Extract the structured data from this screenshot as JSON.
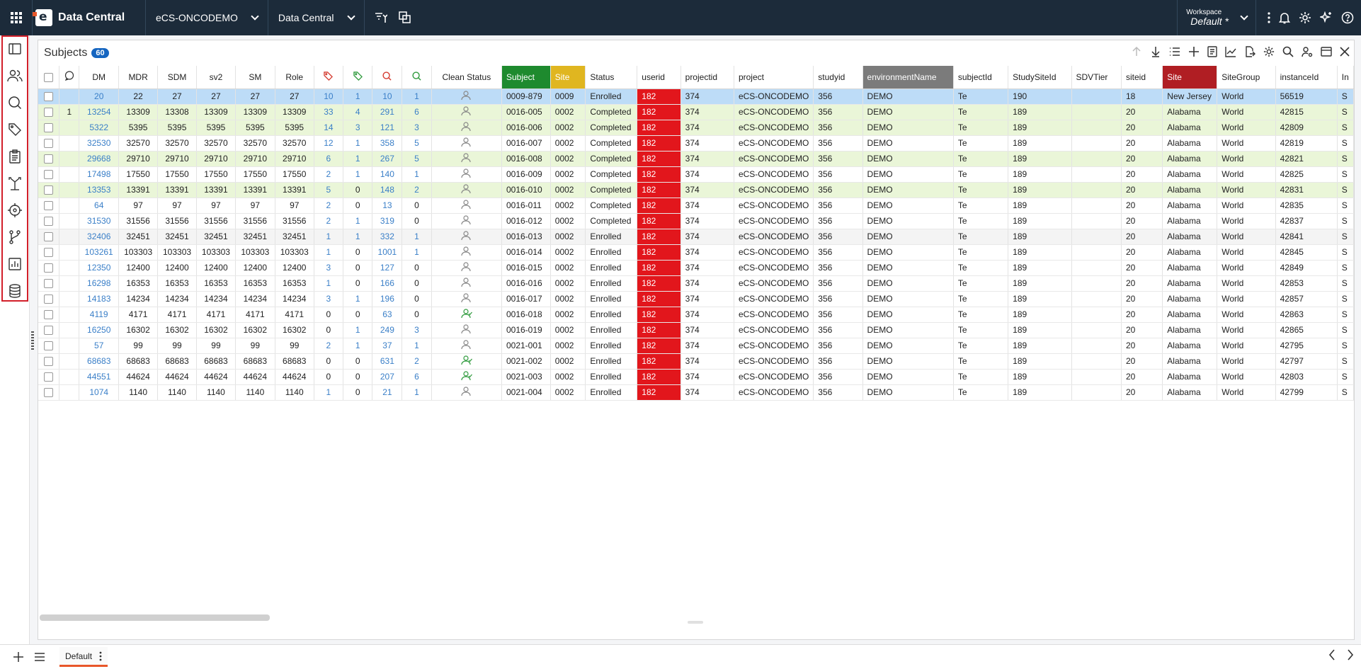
{
  "header": {
    "app_title": "Data Central",
    "study_selector": "eCS-ONCODEMO",
    "module_selector": "Data Central",
    "workspace_label": "Workspace",
    "workspace_value": "Default",
    "workspace_marker": "*"
  },
  "rail": {
    "items": [
      "panel-toggle-icon",
      "subjects-icon",
      "queries-icon",
      "tags-icon",
      "clipboard-icon",
      "branch-arrows-icon",
      "target-icon",
      "git-fork-icon",
      "bar-chart-icon",
      "database-icon"
    ]
  },
  "panel": {
    "title": "Subjects",
    "count": "60"
  },
  "table": {
    "headers": [
      "",
      "",
      "DM",
      "MDR",
      "SDM",
      "sv2",
      "SM",
      "Role",
      "",
      "",
      "",
      "",
      "Clean Status",
      "Subject",
      "Site",
      "Status",
      "userid",
      "projectid",
      "project",
      "studyid",
      "environmentName",
      "subjectId",
      "StudySiteId",
      "SDVTier",
      "siteid",
      "Site",
      "SiteGroup",
      "instanceId",
      "In"
    ],
    "rows": [
      {
        "c": "",
        "dm": "20",
        "mdr": "22",
        "sdm": "27",
        "sv2": "27",
        "sm": "27",
        "role": "27",
        "t1": "10",
        "t2": "1",
        "q1": "10",
        "q2": "1",
        "clean": "person",
        "subject": "0009-879",
        "site": "0009",
        "status": "Enrolled",
        "userid": "182",
        "projectid": "374",
        "project": "eCS-ONCODEMO",
        "studyid": "356",
        "env": "DEMO",
        "subjectId": "Te",
        "studySiteId": "190",
        "sdv": "",
        "siteid": "18",
        "site2": "New Jersey",
        "sitegroup": "World",
        "instance": "56519",
        "in": "S"
      },
      {
        "c": "1",
        "dm": "13254",
        "mdr": "13309",
        "sdm": "13308",
        "sv2": "13309",
        "sm": "13309",
        "role": "13309",
        "t1": "33",
        "t2": "4",
        "q1": "291",
        "q2": "6",
        "clean": "person",
        "subject": "0016-005",
        "site": "0002",
        "status": "Completed",
        "userid": "182",
        "projectid": "374",
        "project": "eCS-ONCODEMO",
        "studyid": "356",
        "env": "DEMO",
        "subjectId": "Te",
        "studySiteId": "189",
        "sdv": "",
        "siteid": "20",
        "site2": "Alabama",
        "sitegroup": "World",
        "instance": "42815",
        "in": "S"
      },
      {
        "c": "",
        "dm": "5322",
        "mdr": "5395",
        "sdm": "5395",
        "sv2": "5395",
        "sm": "5395",
        "role": "5395",
        "t1": "14",
        "t2": "3",
        "q1": "121",
        "q2": "3",
        "clean": "person",
        "subject": "0016-006",
        "site": "0002",
        "status": "Completed",
        "userid": "182",
        "projectid": "374",
        "project": "eCS-ONCODEMO",
        "studyid": "356",
        "env": "DEMO",
        "subjectId": "Te",
        "studySiteId": "189",
        "sdv": "",
        "siteid": "20",
        "site2": "Alabama",
        "sitegroup": "World",
        "instance": "42809",
        "in": "S"
      },
      {
        "c": "",
        "dm": "32530",
        "mdr": "32570",
        "sdm": "32570",
        "sv2": "32570",
        "sm": "32570",
        "role": "32570",
        "t1": "12",
        "t2": "1",
        "q1": "358",
        "q2": "5",
        "clean": "person",
        "subject": "0016-007",
        "site": "0002",
        "status": "Completed",
        "userid": "182",
        "projectid": "374",
        "project": "eCS-ONCODEMO",
        "studyid": "356",
        "env": "DEMO",
        "subjectId": "Te",
        "studySiteId": "189",
        "sdv": "",
        "siteid": "20",
        "site2": "Alabama",
        "sitegroup": "World",
        "instance": "42819",
        "in": "S"
      },
      {
        "c": "",
        "dm": "29668",
        "mdr": "29710",
        "sdm": "29710",
        "sv2": "29710",
        "sm": "29710",
        "role": "29710",
        "t1": "6",
        "t2": "1",
        "q1": "267",
        "q2": "5",
        "clean": "person",
        "subject": "0016-008",
        "site": "0002",
        "status": "Completed",
        "userid": "182",
        "projectid": "374",
        "project": "eCS-ONCODEMO",
        "studyid": "356",
        "env": "DEMO",
        "subjectId": "Te",
        "studySiteId": "189",
        "sdv": "",
        "siteid": "20",
        "site2": "Alabama",
        "sitegroup": "World",
        "instance": "42821",
        "in": "S"
      },
      {
        "c": "",
        "dm": "17498",
        "mdr": "17550",
        "sdm": "17550",
        "sv2": "17550",
        "sm": "17550",
        "role": "17550",
        "t1": "2",
        "t2": "1",
        "q1": "140",
        "q2": "1",
        "clean": "person",
        "subject": "0016-009",
        "site": "0002",
        "status": "Completed",
        "userid": "182",
        "projectid": "374",
        "project": "eCS-ONCODEMO",
        "studyid": "356",
        "env": "DEMO",
        "subjectId": "Te",
        "studySiteId": "189",
        "sdv": "",
        "siteid": "20",
        "site2": "Alabama",
        "sitegroup": "World",
        "instance": "42825",
        "in": "S"
      },
      {
        "c": "",
        "dm": "13353",
        "mdr": "13391",
        "sdm": "13391",
        "sv2": "13391",
        "sm": "13391",
        "role": "13391",
        "t1": "5",
        "t2": "0",
        "q1": "148",
        "q2": "2",
        "clean": "person",
        "subject": "0016-010",
        "site": "0002",
        "status": "Completed",
        "userid": "182",
        "projectid": "374",
        "project": "eCS-ONCODEMO",
        "studyid": "356",
        "env": "DEMO",
        "subjectId": "Te",
        "studySiteId": "189",
        "sdv": "",
        "siteid": "20",
        "site2": "Alabama",
        "sitegroup": "World",
        "instance": "42831",
        "in": "S"
      },
      {
        "c": "",
        "dm": "64",
        "mdr": "97",
        "sdm": "97",
        "sv2": "97",
        "sm": "97",
        "role": "97",
        "t1": "2",
        "t2": "0",
        "q1": "13",
        "q2": "0",
        "clean": "person",
        "subject": "0016-011",
        "site": "0002",
        "status": "Completed",
        "userid": "182",
        "projectid": "374",
        "project": "eCS-ONCODEMO",
        "studyid": "356",
        "env": "DEMO",
        "subjectId": "Te",
        "studySiteId": "189",
        "sdv": "",
        "siteid": "20",
        "site2": "Alabama",
        "sitegroup": "World",
        "instance": "42835",
        "in": "S"
      },
      {
        "c": "",
        "dm": "31530",
        "mdr": "31556",
        "sdm": "31556",
        "sv2": "31556",
        "sm": "31556",
        "role": "31556",
        "t1": "2",
        "t2": "1",
        "q1": "319",
        "q2": "0",
        "clean": "person",
        "subject": "0016-012",
        "site": "0002",
        "status": "Completed",
        "userid": "182",
        "projectid": "374",
        "project": "eCS-ONCODEMO",
        "studyid": "356",
        "env": "DEMO",
        "subjectId": "Te",
        "studySiteId": "189",
        "sdv": "",
        "siteid": "20",
        "site2": "Alabama",
        "sitegroup": "World",
        "instance": "42837",
        "in": "S"
      },
      {
        "c": "",
        "dm": "32406",
        "mdr": "32451",
        "sdm": "32451",
        "sv2": "32451",
        "sm": "32451",
        "role": "32451",
        "t1": "1",
        "t2": "1",
        "q1": "332",
        "q2": "1",
        "clean": "person",
        "subject": "0016-013",
        "site": "0002",
        "status": "Enrolled",
        "userid": "182",
        "projectid": "374",
        "project": "eCS-ONCODEMO",
        "studyid": "356",
        "env": "DEMO",
        "subjectId": "Te",
        "studySiteId": "189",
        "sdv": "",
        "siteid": "20",
        "site2": "Alabama",
        "sitegroup": "World",
        "instance": "42841",
        "in": "S"
      },
      {
        "c": "",
        "dm": "103261",
        "mdr": "103303",
        "sdm": "103303",
        "sv2": "103303",
        "sm": "103303",
        "role": "103303",
        "t1": "1",
        "t2": "0",
        "q1": "1001",
        "q2": "1",
        "clean": "person",
        "subject": "0016-014",
        "site": "0002",
        "status": "Enrolled",
        "userid": "182",
        "projectid": "374",
        "project": "eCS-ONCODEMO",
        "studyid": "356",
        "env": "DEMO",
        "subjectId": "Te",
        "studySiteId": "189",
        "sdv": "",
        "siteid": "20",
        "site2": "Alabama",
        "sitegroup": "World",
        "instance": "42845",
        "in": "S"
      },
      {
        "c": "",
        "dm": "12350",
        "mdr": "12400",
        "sdm": "12400",
        "sv2": "12400",
        "sm": "12400",
        "role": "12400",
        "t1": "3",
        "t2": "0",
        "q1": "127",
        "q2": "0",
        "clean": "person",
        "subject": "0016-015",
        "site": "0002",
        "status": "Enrolled",
        "userid": "182",
        "projectid": "374",
        "project": "eCS-ONCODEMO",
        "studyid": "356",
        "env": "DEMO",
        "subjectId": "Te",
        "studySiteId": "189",
        "sdv": "",
        "siteid": "20",
        "site2": "Alabama",
        "sitegroup": "World",
        "instance": "42849",
        "in": "S"
      },
      {
        "c": "",
        "dm": "16298",
        "mdr": "16353",
        "sdm": "16353",
        "sv2": "16353",
        "sm": "16353",
        "role": "16353",
        "t1": "1",
        "t2": "0",
        "q1": "166",
        "q2": "0",
        "clean": "person",
        "subject": "0016-016",
        "site": "0002",
        "status": "Enrolled",
        "userid": "182",
        "projectid": "374",
        "project": "eCS-ONCODEMO",
        "studyid": "356",
        "env": "DEMO",
        "subjectId": "Te",
        "studySiteId": "189",
        "sdv": "",
        "siteid": "20",
        "site2": "Alabama",
        "sitegroup": "World",
        "instance": "42853",
        "in": "S"
      },
      {
        "c": "",
        "dm": "14183",
        "mdr": "14234",
        "sdm": "14234",
        "sv2": "14234",
        "sm": "14234",
        "role": "14234",
        "t1": "3",
        "t2": "1",
        "q1": "196",
        "q2": "0",
        "clean": "person",
        "subject": "0016-017",
        "site": "0002",
        "status": "Enrolled",
        "userid": "182",
        "projectid": "374",
        "project": "eCS-ONCODEMO",
        "studyid": "356",
        "env": "DEMO",
        "subjectId": "Te",
        "studySiteId": "189",
        "sdv": "",
        "siteid": "20",
        "site2": "Alabama",
        "sitegroup": "World",
        "instance": "42857",
        "in": "S"
      },
      {
        "c": "",
        "dm": "4119",
        "mdr": "4171",
        "sdm": "4171",
        "sv2": "4171",
        "sm": "4171",
        "role": "4171",
        "t1": "0",
        "t2": "0",
        "q1": "63",
        "q2": "0",
        "clean": "person-check",
        "subject": "0016-018",
        "site": "0002",
        "status": "Enrolled",
        "userid": "182",
        "projectid": "374",
        "project": "eCS-ONCODEMO",
        "studyid": "356",
        "env": "DEMO",
        "subjectId": "Te",
        "studySiteId": "189",
        "sdv": "",
        "siteid": "20",
        "site2": "Alabama",
        "sitegroup": "World",
        "instance": "42863",
        "in": "S"
      },
      {
        "c": "",
        "dm": "16250",
        "mdr": "16302",
        "sdm": "16302",
        "sv2": "16302",
        "sm": "16302",
        "role": "16302",
        "t1": "0",
        "t2": "1",
        "q1": "249",
        "q2": "3",
        "clean": "person",
        "subject": "0016-019",
        "site": "0002",
        "status": "Enrolled",
        "userid": "182",
        "projectid": "374",
        "project": "eCS-ONCODEMO",
        "studyid": "356",
        "env": "DEMO",
        "subjectId": "Te",
        "studySiteId": "189",
        "sdv": "",
        "siteid": "20",
        "site2": "Alabama",
        "sitegroup": "World",
        "instance": "42865",
        "in": "S"
      },
      {
        "c": "",
        "dm": "57",
        "mdr": "99",
        "sdm": "99",
        "sv2": "99",
        "sm": "99",
        "role": "99",
        "t1": "2",
        "t2": "1",
        "q1": "37",
        "q2": "1",
        "clean": "person",
        "subject": "0021-001",
        "site": "0002",
        "status": "Enrolled",
        "userid": "182",
        "projectid": "374",
        "project": "eCS-ONCODEMO",
        "studyid": "356",
        "env": "DEMO",
        "subjectId": "Te",
        "studySiteId": "189",
        "sdv": "",
        "siteid": "20",
        "site2": "Alabama",
        "sitegroup": "World",
        "instance": "42795",
        "in": "S"
      },
      {
        "c": "",
        "dm": "68683",
        "mdr": "68683",
        "sdm": "68683",
        "sv2": "68683",
        "sm": "68683",
        "role": "68683",
        "t1": "0",
        "t2": "0",
        "q1": "631",
        "q2": "2",
        "clean": "person-check",
        "subject": "0021-002",
        "site": "0002",
        "status": "Enrolled",
        "userid": "182",
        "projectid": "374",
        "project": "eCS-ONCODEMO",
        "studyid": "356",
        "env": "DEMO",
        "subjectId": "Te",
        "studySiteId": "189",
        "sdv": "",
        "siteid": "20",
        "site2": "Alabama",
        "sitegroup": "World",
        "instance": "42797",
        "in": "S"
      },
      {
        "c": "",
        "dm": "44551",
        "mdr": "44624",
        "sdm": "44624",
        "sv2": "44624",
        "sm": "44624",
        "role": "44624",
        "t1": "0",
        "t2": "0",
        "q1": "207",
        "q2": "6",
        "clean": "person-check",
        "subject": "0021-003",
        "site": "0002",
        "status": "Enrolled",
        "userid": "182",
        "projectid": "374",
        "project": "eCS-ONCODEMO",
        "studyid": "356",
        "env": "DEMO",
        "subjectId": "Te",
        "studySiteId": "189",
        "sdv": "",
        "siteid": "20",
        "site2": "Alabama",
        "sitegroup": "World",
        "instance": "42803",
        "in": "S"
      },
      {
        "c": "",
        "dm": "1074",
        "mdr": "1140",
        "sdm": "1140",
        "sv2": "1140",
        "sm": "1140",
        "role": "1140",
        "t1": "1",
        "t2": "0",
        "q1": "21",
        "q2": "1",
        "clean": "person",
        "subject": "0021-004",
        "site": "0002",
        "status": "Enrolled",
        "userid": "182",
        "projectid": "374",
        "project": "eCS-ONCODEMO",
        "studyid": "356",
        "env": "DEMO",
        "subjectId": "Te",
        "studySiteId": "189",
        "sdv": "",
        "siteid": "20",
        "site2": "Alabama",
        "sitegroup": "World",
        "instance": "42799",
        "in": "S"
      }
    ]
  },
  "footer": {
    "tab_label": "Default"
  },
  "colors": {
    "topbar": "#1c2b3a",
    "selected_row": "#bddcf7",
    "green_row": "#eaf6d8",
    "userid_cell": "#e2161c",
    "link": "#3a7fc8",
    "badge": "#1565c0"
  }
}
